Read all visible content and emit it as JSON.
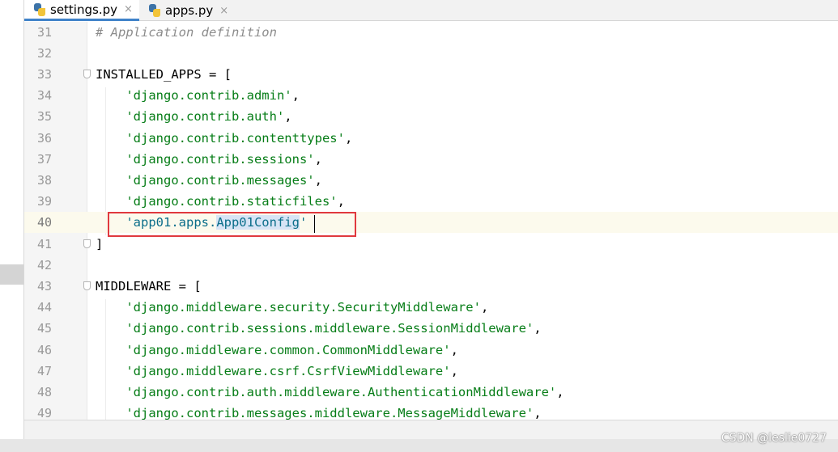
{
  "tabs": [
    {
      "label": "settings.py",
      "active": true,
      "icon": "python-file-icon"
    },
    {
      "label": "apps.py",
      "active": false,
      "icon": "python-file-icon"
    }
  ],
  "tab_close_glyph": "×",
  "editor": {
    "current_line": "40",
    "lines": [
      {
        "num": "31",
        "parts": [
          {
            "t": "# Application definition",
            "k": "comment"
          }
        ]
      },
      {
        "num": "32",
        "parts": []
      },
      {
        "num": "33",
        "parts": [
          {
            "t": "INSTALLED_APPS = [",
            "k": "plain"
          }
        ]
      },
      {
        "num": "34",
        "parts": [
          {
            "t": "    ",
            "k": "plain"
          },
          {
            "t": "'django.contrib.admin'",
            "k": "string"
          },
          {
            "t": ",",
            "k": "plain"
          }
        ]
      },
      {
        "num": "35",
        "parts": [
          {
            "t": "    ",
            "k": "plain"
          },
          {
            "t": "'django.contrib.auth'",
            "k": "string"
          },
          {
            "t": ",",
            "k": "plain"
          }
        ]
      },
      {
        "num": "36",
        "parts": [
          {
            "t": "    ",
            "k": "plain"
          },
          {
            "t": "'django.contrib.contenttypes'",
            "k": "string"
          },
          {
            "t": ",",
            "k": "plain"
          }
        ]
      },
      {
        "num": "37",
        "parts": [
          {
            "t": "    ",
            "k": "plain"
          },
          {
            "t": "'django.contrib.sessions'",
            "k": "string"
          },
          {
            "t": ",",
            "k": "plain"
          }
        ]
      },
      {
        "num": "38",
        "parts": [
          {
            "t": "    ",
            "k": "plain"
          },
          {
            "t": "'django.contrib.messages'",
            "k": "string"
          },
          {
            "t": ",",
            "k": "plain"
          }
        ]
      },
      {
        "num": "39",
        "parts": [
          {
            "t": "    ",
            "k": "plain"
          },
          {
            "t": "'django.contrib.staticfiles'",
            "k": "string"
          },
          {
            "t": ",",
            "k": "plain"
          }
        ]
      },
      {
        "num": "40",
        "parts": [
          {
            "t": "    ",
            "k": "plain"
          },
          {
            "t": "'app01.apps.",
            "k": "string"
          },
          {
            "t": "App01Config",
            "k": "selected"
          },
          {
            "t": "'",
            "k": "string"
          }
        ]
      },
      {
        "num": "41",
        "parts": [
          {
            "t": "]",
            "k": "plain"
          }
        ]
      },
      {
        "num": "42",
        "parts": []
      },
      {
        "num": "43",
        "parts": [
          {
            "t": "MIDDLEWARE = [",
            "k": "plain"
          }
        ]
      },
      {
        "num": "44",
        "parts": [
          {
            "t": "    ",
            "k": "plain"
          },
          {
            "t": "'django.middleware.security.SecurityMiddleware'",
            "k": "string"
          },
          {
            "t": ",",
            "k": "plain"
          }
        ]
      },
      {
        "num": "45",
        "parts": [
          {
            "t": "    ",
            "k": "plain"
          },
          {
            "t": "'django.contrib.sessions.middleware.SessionMiddleware'",
            "k": "string"
          },
          {
            "t": ",",
            "k": "plain"
          }
        ]
      },
      {
        "num": "46",
        "parts": [
          {
            "t": "    ",
            "k": "plain"
          },
          {
            "t": "'django.middleware.common.CommonMiddleware'",
            "k": "string"
          },
          {
            "t": ",",
            "k": "plain"
          }
        ]
      },
      {
        "num": "47",
        "parts": [
          {
            "t": "    ",
            "k": "plain"
          },
          {
            "t": "'django.middleware.csrf.CsrfViewMiddleware'",
            "k": "string"
          },
          {
            "t": ",",
            "k": "plain"
          }
        ]
      },
      {
        "num": "48",
        "parts": [
          {
            "t": "    ",
            "k": "plain"
          },
          {
            "t": "'django.contrib.auth.middleware.AuthenticationMiddleware'",
            "k": "string"
          },
          {
            "t": ",",
            "k": "plain"
          }
        ]
      },
      {
        "num": "49",
        "parts": [
          {
            "t": "    ",
            "k": "plain"
          },
          {
            "t": "'django.contrib.messages.middleware.MessageMiddleware'",
            "k": "string"
          },
          {
            "t": ",",
            "k": "plain"
          }
        ]
      }
    ],
    "fold_lines": [
      "33",
      "41",
      "43"
    ]
  },
  "colors": {
    "string": "#067d17",
    "comment": "#8c8c8c",
    "selection": "#d7e4f5",
    "highlight_box": "#e0393e",
    "current_line": "#fcfaed"
  },
  "watermark": "CSDN @leslie0727"
}
